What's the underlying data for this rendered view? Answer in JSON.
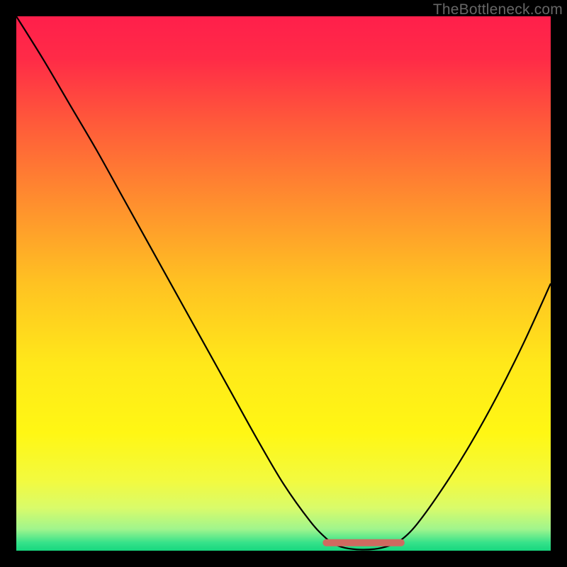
{
  "watermark": "TheBottleneck.com",
  "chart_data": {
    "type": "line",
    "title": "",
    "xlabel": "",
    "ylabel": "",
    "xlim": [
      0,
      100
    ],
    "ylim": [
      0,
      100
    ],
    "grid": false,
    "background_gradient": {
      "stops": [
        {
          "offset": 0.0,
          "color": "#ff1f4b"
        },
        {
          "offset": 0.08,
          "color": "#ff2b47"
        },
        {
          "offset": 0.2,
          "color": "#ff5a3a"
        },
        {
          "offset": 0.35,
          "color": "#ff8f2e"
        },
        {
          "offset": 0.5,
          "color": "#ffc222"
        },
        {
          "offset": 0.65,
          "color": "#ffe81a"
        },
        {
          "offset": 0.78,
          "color": "#fff714"
        },
        {
          "offset": 0.87,
          "color": "#f2fa40"
        },
        {
          "offset": 0.92,
          "color": "#d9fb6a"
        },
        {
          "offset": 0.96,
          "color": "#9ff58d"
        },
        {
          "offset": 0.985,
          "color": "#36e28a"
        },
        {
          "offset": 1.0,
          "color": "#17d77f"
        }
      ]
    },
    "series": [
      {
        "name": "bottleneck-curve",
        "stroke": "#000000",
        "stroke_width": 2.2,
        "x": [
          0.0,
          5,
          10,
          15,
          20,
          25,
          30,
          35,
          40,
          45,
          50,
          55,
          58,
          60,
          63,
          67,
          70,
          72,
          75,
          80,
          85,
          90,
          95,
          100
        ],
        "y": [
          100,
          92,
          83.5,
          75,
          66,
          57,
          48,
          39,
          30,
          21,
          12.5,
          5.5,
          2.3,
          1.0,
          0.3,
          0.3,
          1.0,
          2.0,
          5.0,
          12,
          20,
          29,
          39,
          50
        ]
      }
    ],
    "highlight_segment": {
      "name": "optimal-range",
      "stroke": "#cf6a60",
      "stroke_width": 10,
      "x": [
        58,
        72
      ],
      "y": [
        1.5,
        1.5
      ]
    }
  }
}
